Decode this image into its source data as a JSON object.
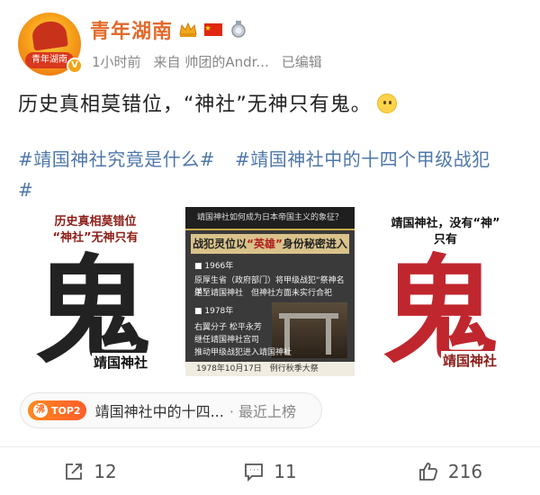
{
  "author": {
    "name": "青年湖南",
    "avatar_text": "青年湖南",
    "time": "1小时前",
    "source_prefix": "来自",
    "source": "帅团的Andr...",
    "edited": "已编辑",
    "badges": [
      "crown-badge-icon",
      "china-flag-icon",
      "medal-badge-icon"
    ]
  },
  "post": {
    "text": "历史真相莫错位，“神社”无神只有鬼。",
    "hashtags": [
      "#靖国神社究竟是什么#",
      "#靖国神社中的十四个甲级战犯#"
    ]
  },
  "images": {
    "left": {
      "caption_line1": "历史真相莫错位",
      "caption_line2": "“神社”无神只有",
      "big_char": "鬼",
      "overlay": "靖国神社"
    },
    "middle": {
      "top": "靖国神社如何成为日本帝国主义的象征？",
      "headline_prefix": "战犯灵位以",
      "headline_em": "“英雄”",
      "headline_suffix": "身份秘密进入",
      "line1": "1966年",
      "line2": "原厚生省（政府部门）将甲级战犯“祭神名单”",
      "line3": "送至靖国神社　但神社方面未实行合祀",
      "line4": "1978年",
      "line5": "右翼分子 松平永芳",
      "line6": "继任靖国神社宫司",
      "line7": "推动甲级战犯进入靖国神社",
      "bottom": "1978年10月17日　例行秋季大祭"
    },
    "right": {
      "caption_line1": "靖国神社，没有“神”",
      "caption_line2": "只有",
      "big_char": "鬼",
      "overlay": "靖国神社"
    }
  },
  "hot": {
    "icon_char": "沸",
    "rank": "TOP2",
    "text": "靖国神社中的十四...",
    "tail": "· 最近上榜"
  },
  "actions": {
    "share_count": "12",
    "comment_count": "11",
    "like_count": "216"
  }
}
